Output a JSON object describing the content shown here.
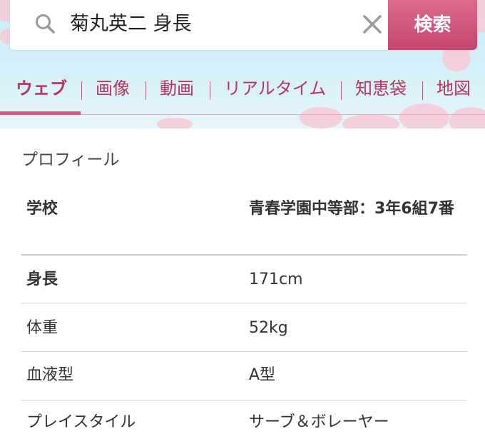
{
  "search": {
    "query": "菊丸英二 身長",
    "button_label": "検索"
  },
  "tabs": [
    {
      "label": "ウェブ",
      "active": true
    },
    {
      "label": "画像",
      "active": false
    },
    {
      "label": "動画",
      "active": false
    },
    {
      "label": "リアルタイム",
      "active": false
    },
    {
      "label": "知恵袋",
      "active": false
    },
    {
      "label": "地図",
      "active": false
    }
  ],
  "profile": {
    "title": "プロフィール",
    "rows": [
      {
        "label": "学校",
        "value": "青春学園中等部：3年6組7番"
      },
      {
        "label": "身長",
        "value": "171cm"
      },
      {
        "label": "体重",
        "value": "52kg"
      },
      {
        "label": "血液型",
        "value": "A型"
      },
      {
        "label": "プレイスタイル",
        "value": "サーブ＆ボレーヤー"
      }
    ]
  },
  "colors": {
    "accent": "#b8345e",
    "search_button": "#d45c83",
    "header_sky": "#c9ecf6",
    "sakura": "#f7c9d6"
  }
}
